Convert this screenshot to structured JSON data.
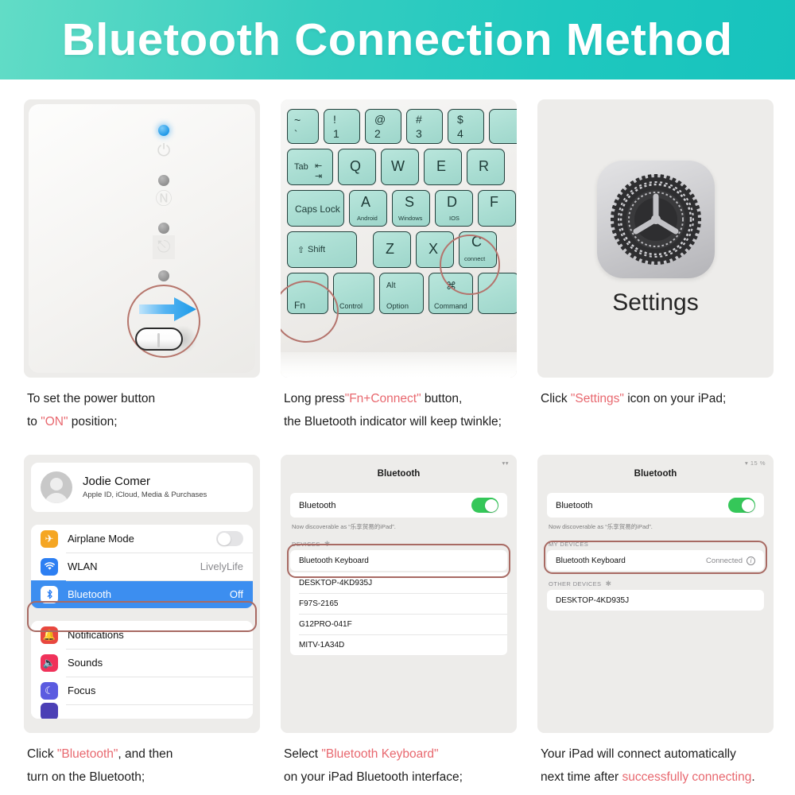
{
  "header": {
    "title": "Bluetooth Connection Method",
    "bg_color": "#2ecdc0"
  },
  "accent": {
    "highlight_text": "#e8686f",
    "circle": "#b4746d",
    "selected_row": "#3c8ef0",
    "toggle_on": "#35c759",
    "led_blue": "#2196f3"
  },
  "panels": {
    "step1": {
      "caption_line1_a": "To set the power button",
      "caption_line2_a": "to ",
      "caption_line2_hl": "\"ON\"",
      "caption_line2_b": " position;",
      "leds": [
        "blue",
        "gray",
        "gray",
        "gray"
      ],
      "glyphs": [
        "⏻",
        "Ⓝ",
        "⎋"
      ],
      "watermark": ""
    },
    "step2": {
      "caption_a": "Long press",
      "caption_hl": "\"Fn+Connect\"",
      "caption_b": " button,",
      "caption_line2": "the Bluetooth indicator will keep twinkle;",
      "keys_row1": [
        {
          "main": "~",
          "sub": "`"
        },
        {
          "main": "!",
          "sub": "1"
        },
        {
          "main": "@",
          "sub": "2"
        },
        {
          "main": "#",
          "sub": "3"
        },
        {
          "main": "$",
          "sub": "4"
        }
      ],
      "keys_row2": [
        "Tab",
        "Q",
        "W",
        "E",
        "R"
      ],
      "keys_row3": [
        {
          "main": "Caps Lock",
          "sub": ""
        },
        {
          "main": "A",
          "sub": "Android"
        },
        {
          "main": "S",
          "sub": "Windows"
        },
        {
          "main": "D",
          "sub": "IOS"
        },
        {
          "main": "F",
          "sub": ""
        }
      ],
      "keys_row4": [
        {
          "main": "Shift",
          "sub": ""
        },
        {
          "main": "Z",
          "sub": ""
        },
        {
          "main": "X",
          "sub": ""
        },
        {
          "main": "C",
          "sub": "connect"
        }
      ],
      "keys_row5": [
        {
          "main": "Fn",
          "sub": ""
        },
        {
          "main": "Control",
          "sub": ""
        },
        {
          "main": "Alt",
          "sub": "Option"
        },
        {
          "main": "⌘",
          "sub": "Command"
        }
      ],
      "circled_keys": [
        "Fn",
        "C"
      ]
    },
    "step3": {
      "icon_label": "Settings",
      "caption_a": "Click ",
      "caption_hl": "\"Settings\"",
      "caption_b": " icon on your iPad;"
    },
    "step4": {
      "caption_a": "Click ",
      "caption_hl": "\"Bluetooth\"",
      "caption_b": ", and then",
      "caption_line2": "turn on the Bluetooth;",
      "account": {
        "name": "Jodie Comer",
        "subtitle": "Apple ID, iCloud, Media & Purchases"
      },
      "group1": [
        {
          "label": "Airplane Mode",
          "value": "",
          "control": "toggle-off",
          "icon": "airplane-icon",
          "icon_color": "#f5a623",
          "glyph": "✈"
        },
        {
          "label": "WLAN",
          "value": "LivelyLife",
          "control": "",
          "icon": "wifi-icon",
          "icon_color": "#2d7ff2",
          "glyph": "◓"
        },
        {
          "label": "Bluetooth",
          "value": "Off",
          "control": "",
          "icon": "bluetooth-icon",
          "icon_color": "#2d7ff2",
          "glyph": "ᛦ",
          "selected": true
        }
      ],
      "group2": [
        {
          "label": "Notifications",
          "value": "",
          "icon": "notifications-icon",
          "icon_color": "#e8473f",
          "glyph": "◉"
        },
        {
          "label": "Sounds",
          "value": "",
          "icon": "sounds-icon",
          "icon_color": "#f0325a",
          "glyph": "▶"
        },
        {
          "label": "Focus",
          "value": "",
          "icon": "focus-icon",
          "icon_color": "#5b5be0",
          "glyph": "☽"
        }
      ]
    },
    "step5": {
      "caption_a": "Select ",
      "caption_hl": "\"Bluetooth Keyboard\"",
      "caption_b": "",
      "caption_line2": "on your iPad Bluetooth interface;",
      "status_bar": "",
      "title": "Bluetooth",
      "toggle_label": "Bluetooth",
      "toggle_state": "on",
      "discoverable_note": "Now discoverable as “乐享贸易的iPad”.",
      "section_label": "DEVICES",
      "devices": [
        {
          "name": "Bluetooth Keyboard",
          "status": "",
          "highlighted": true
        },
        {
          "name": "DESKTOP-4KD935J",
          "status": ""
        },
        {
          "name": "F97S-2165",
          "status": ""
        },
        {
          "name": "G12PRO-041F",
          "status": ""
        },
        {
          "name": "MITV-1A34D",
          "status": ""
        }
      ]
    },
    "step6": {
      "caption_line1": "Your iPad will connect automatically",
      "caption_line2_a": "next time after ",
      "caption_line2_hl": "successfully connecting",
      "caption_line2_b": ".",
      "status_bar": "15 %",
      "title": "Bluetooth",
      "toggle_label": "Bluetooth",
      "toggle_state": "on",
      "discoverable_note": "Now discoverable as “乐享贸易的iPad”.",
      "my_devices_label": "MY DEVICES",
      "my_devices": [
        {
          "name": "Bluetooth Keyboard",
          "status": "Connected",
          "highlighted": true
        }
      ],
      "other_devices_label": "OTHER DEVICES",
      "other_devices": [
        {
          "name": "DESKTOP-4KD935J",
          "status": ""
        }
      ]
    }
  }
}
